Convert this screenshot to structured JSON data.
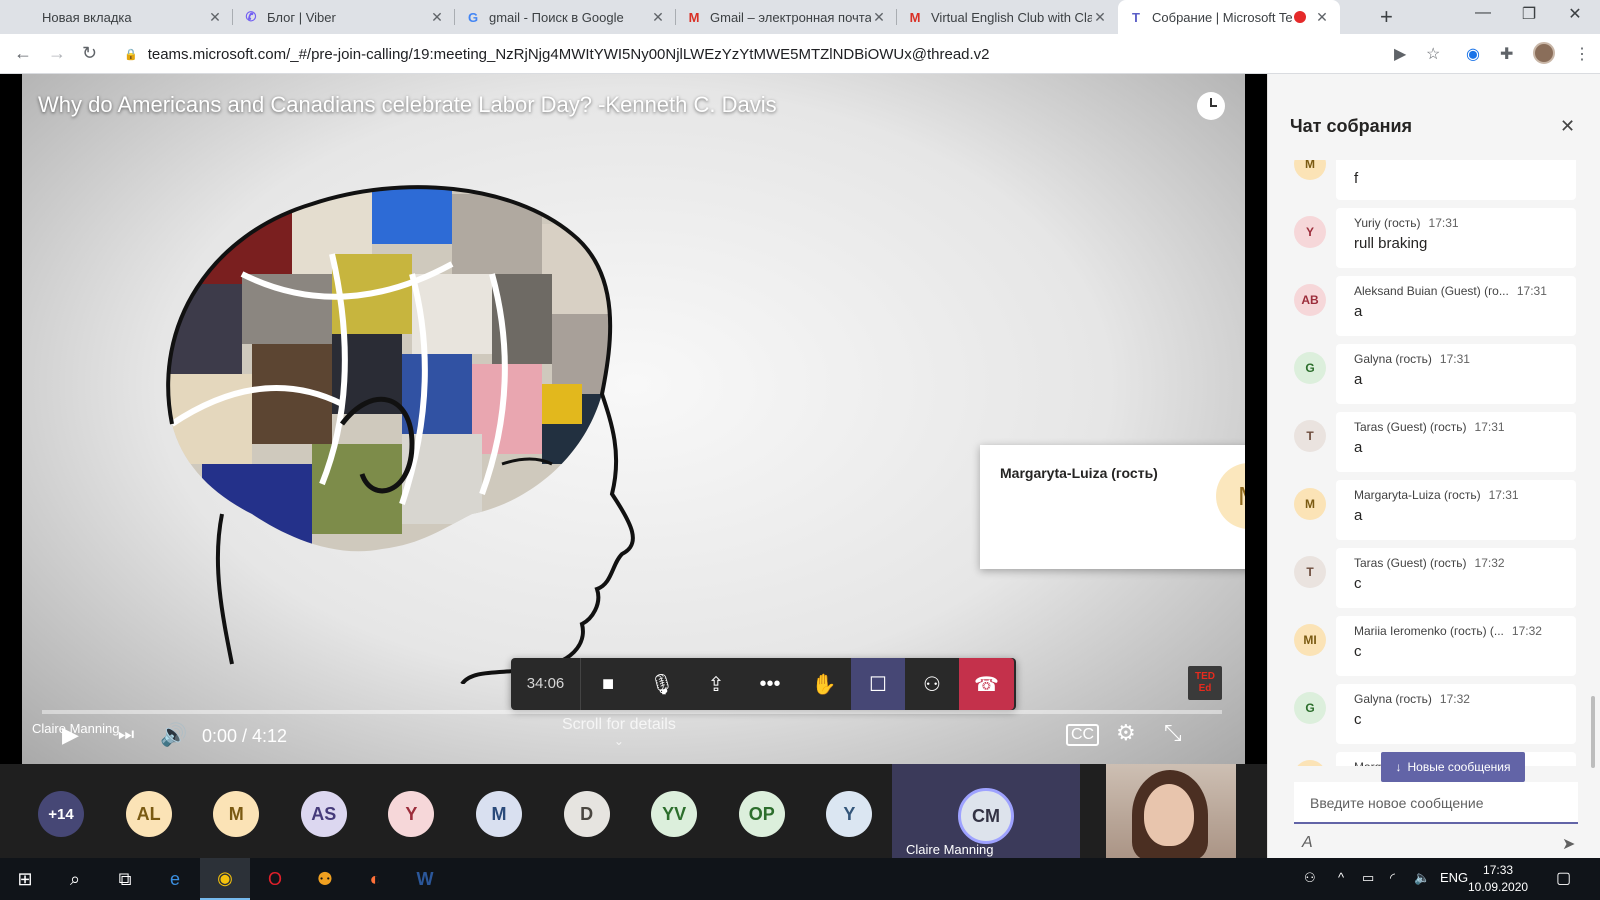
{
  "browser": {
    "tabs": [
      {
        "title": "Новая вкладка",
        "icon": "blank-page-icon",
        "fav": ""
      },
      {
        "title": "Блог | Viber",
        "icon": "viber-icon",
        "fav": "✆",
        "color": "#7360f2"
      },
      {
        "title": "gmail - Поиск в Google",
        "icon": "google-icon",
        "fav": "G",
        "color": "#4285f4"
      },
      {
        "title": "Gmail – электронная почта",
        "icon": "gmail-icon",
        "fav": "M",
        "color": "#d93025"
      },
      {
        "title": "Virtual English Club with Clai",
        "icon": "gmail-icon",
        "fav": "M",
        "color": "#d93025"
      },
      {
        "title": "Собрание | Microsoft Te",
        "icon": "teams-icon",
        "fav": "T",
        "color": "#5b5fc7"
      }
    ],
    "url": "teams.microsoft.com/_#/pre-join-calling/19:meeting_NzRjNjg4MWItYWI5Ny00NjlLWEzYzYtMWE5MTZlNDBiOWUx@thread.v2"
  },
  "video": {
    "title": "Why do Americans and Canadians celebrate Labor Day? -Kenneth C. Davis",
    "time": "0:00 / 4:12",
    "scroll_hint": "Scroll for details",
    "caption_name": "Claire Manning",
    "ted_logo": "TED Ed"
  },
  "call": {
    "timer": "34:06",
    "card_name": "Margaryta-Luiza (гость)",
    "card_initial": "M"
  },
  "participants": [
    {
      "initials": "+14",
      "bg": "#464775",
      "fg": "#ffffff"
    },
    {
      "initials": "AL",
      "bg": "#fbe3b6",
      "fg": "#7a5a12"
    },
    {
      "initials": "M",
      "bg": "#fbe3b6",
      "fg": "#7a5a12"
    },
    {
      "initials": "AS",
      "bg": "#dcd7f0",
      "fg": "#453a7a"
    },
    {
      "initials": "Y",
      "bg": "#f6d7d9",
      "fg": "#9c2d3b"
    },
    {
      "initials": "M",
      "bg": "#d9e0f0",
      "fg": "#2a4a7a"
    },
    {
      "initials": "D",
      "bg": "#e6e4e0",
      "fg": "#4a4640"
    },
    {
      "initials": "YV",
      "bg": "#dcefdc",
      "fg": "#2c6e2c"
    },
    {
      "initials": "OP",
      "bg": "#dcefdc",
      "fg": "#2c6e2c"
    },
    {
      "initials": "Y",
      "bg": "#dbe6f2",
      "fg": "#34567a"
    }
  ],
  "speaker": {
    "initials": "CM",
    "name": "Claire Manning"
  },
  "chat": {
    "title": "Чат собрания",
    "messages": [
      {
        "initials": "M",
        "author": "",
        "time": "",
        "text": "f",
        "bg": "#fbe3b6",
        "fg": "#7a5a12"
      },
      {
        "initials": "Y",
        "author": "Yuriy (гость)",
        "time": "17:31",
        "text": "rull braking",
        "bg": "#f6d7d9",
        "fg": "#9c2d3b"
      },
      {
        "initials": "AB",
        "author": "Aleksand Buian (Guest) (го...",
        "time": "17:31",
        "text": "a",
        "bg": "#f6d7d9",
        "fg": "#9c2d3b"
      },
      {
        "initials": "G",
        "author": "Galyna (гость)",
        "time": "17:31",
        "text": "a",
        "bg": "#dcefdc",
        "fg": "#2c6e2c"
      },
      {
        "initials": "T",
        "author": "Taras (Guest) (гость)",
        "time": "17:31",
        "text": "a",
        "bg": "#eae3df",
        "fg": "#6d4c3c"
      },
      {
        "initials": "M",
        "author": "Margaryta-Luiza (гость)",
        "time": "17:31",
        "text": "a",
        "bg": "#fbe3b6",
        "fg": "#7a5a12"
      },
      {
        "initials": "T",
        "author": "Taras (Guest) (гость)",
        "time": "17:32",
        "text": "c",
        "bg": "#eae3df",
        "fg": "#6d4c3c"
      },
      {
        "initials": "MI",
        "author": "Mariia Ieromenko (гость) (...",
        "time": "17:32",
        "text": "c",
        "bg": "#fbe3b6",
        "fg": "#7a5a12"
      },
      {
        "initials": "G",
        "author": "Galyna (гость)",
        "time": "17:32",
        "text": "c",
        "bg": "#dcefdc",
        "fg": "#2c6e2c"
      },
      {
        "initials": "M",
        "author": "Margary",
        "time": "",
        "text": "",
        "bg": "#fbe3b6",
        "fg": "#7a5a12"
      }
    ],
    "new_messages_label": "Новые сообщения",
    "compose_placeholder": "Введите новое сообщение"
  },
  "taskbar": {
    "lang": "ENG",
    "time": "17:33",
    "date": "10.09.2020"
  }
}
